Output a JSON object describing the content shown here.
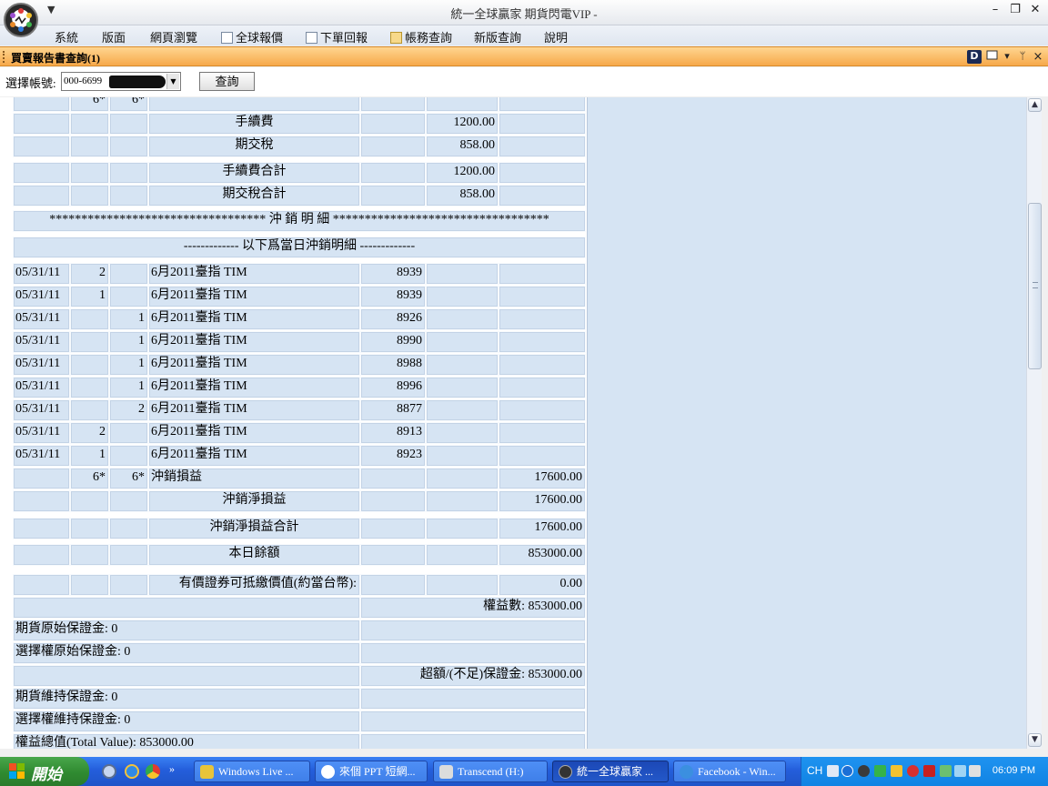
{
  "window": {
    "title": "統一全球贏家 期貨閃電VIP -",
    "qa_arrow": "▼",
    "min": "–",
    "restore": "❐",
    "close": "✕"
  },
  "menu": {
    "items": [
      {
        "label": "系統",
        "icon": null
      },
      {
        "label": "版面",
        "icon": null
      },
      {
        "label": "網頁瀏覽",
        "icon": null
      },
      {
        "label": "全球報價",
        "icon": "quote-icon"
      },
      {
        "label": "下單回報",
        "icon": "order-icon"
      },
      {
        "label": "帳務查詢",
        "icon": "account-icon"
      },
      {
        "label": "新版查詢",
        "icon": null
      },
      {
        "label": "說明",
        "icon": null
      }
    ]
  },
  "panel": {
    "title": "買賣報告書查詢(1)",
    "btn_d": "D",
    "btn_pin": "ᛘ",
    "btn_close": "×"
  },
  "account": {
    "label": "選擇帳號:",
    "value": "000-6699",
    "query_label": "查詢"
  },
  "report": {
    "rows": [
      [
        "",
        "6*",
        "6*",
        "",
        "",
        "",
        ""
      ],
      [
        "",
        "",
        "",
        "手續費",
        "",
        "1200.00",
        ""
      ],
      [
        "",
        "",
        "",
        "期交稅",
        "",
        "858.00",
        ""
      ],
      [
        "",
        "",
        "",
        "手續費合計",
        "",
        "1200.00",
        ""
      ],
      [
        "",
        "",
        "",
        "期交稅合計",
        "",
        "858.00",
        ""
      ],
      [
        "********************************** 沖 銷 明 細 **********************************"
      ],
      [
        "------------- 以下爲當日沖銷明細 -------------"
      ],
      [
        "05/31/11",
        "2",
        "",
        "6月2011臺指 TIM",
        "8939",
        "",
        ""
      ],
      [
        "05/31/11",
        "1",
        "",
        "6月2011臺指 TIM",
        "8939",
        "",
        ""
      ],
      [
        "05/31/11",
        "",
        "1",
        "6月2011臺指 TIM",
        "8926",
        "",
        ""
      ],
      [
        "05/31/11",
        "",
        "1",
        "6月2011臺指 TIM",
        "8990",
        "",
        ""
      ],
      [
        "05/31/11",
        "",
        "1",
        "6月2011臺指 TIM",
        "8988",
        "",
        ""
      ],
      [
        "05/31/11",
        "",
        "1",
        "6月2011臺指 TIM",
        "8996",
        "",
        ""
      ],
      [
        "05/31/11",
        "",
        "2",
        "6月2011臺指 TIM",
        "8877",
        "",
        ""
      ],
      [
        "05/31/11",
        "2",
        "",
        "6月2011臺指 TIM",
        "8913",
        "",
        ""
      ],
      [
        "05/31/11",
        "1",
        "",
        "6月2011臺指 TIM",
        "8923",
        "",
        ""
      ],
      [
        "",
        "6*",
        "6*",
        "沖銷損益",
        "",
        "",
        "17600.00"
      ],
      [
        "",
        "",
        "",
        "沖銷淨損益",
        "",
        "",
        "17600.00"
      ],
      [
        "",
        "",
        "",
        "沖銷淨損益合計",
        "",
        "",
        "17600.00"
      ],
      [
        "",
        "",
        "",
        "本日餘額",
        "",
        "",
        "853000.00"
      ],
      [
        "",
        "",
        "",
        "有價證券可抵繳價值(約當台幣):",
        "",
        "",
        "0.00"
      ],
      [
        "",
        "權益數: 853000.00"
      ],
      [
        "期貨原始保證金: 0",
        ""
      ],
      [
        "選擇權原始保證金: 0",
        ""
      ],
      [
        "",
        "超額/(不足)保證金: 853000.00"
      ],
      [
        "期貨維持保證金: 0",
        ""
      ],
      [
        "選擇權維持保證金: 0",
        ""
      ],
      [
        "權益總值(Total Value): 853000.00",
        ""
      ]
    ]
  },
  "scrollbar": {
    "up": "▲",
    "down": "▼"
  },
  "taskbar": {
    "start_label": "開始",
    "chevron": "»",
    "tasks": [
      {
        "label": "Windows Live ...",
        "color": "#e8c43a",
        "active": false
      },
      {
        "label": "來個 PPT 短網...",
        "color": "#ffffff",
        "active": false
      },
      {
        "label": "Transcend (H:)",
        "color": "#dcdcdc",
        "active": false
      },
      {
        "label": "統一全球贏家 ...",
        "color": "#333333",
        "active": true
      },
      {
        "label": "Facebook - Win...",
        "color": "#3b8fe0",
        "active": false
      }
    ],
    "tray_lang": "CH",
    "time": "06:09 PM"
  },
  "colors": {
    "cell_bg": "#d6e4f3",
    "header_orange": "#f6a94a",
    "taskbar_blue": "#245edb",
    "start_green": "#2f8a30"
  }
}
